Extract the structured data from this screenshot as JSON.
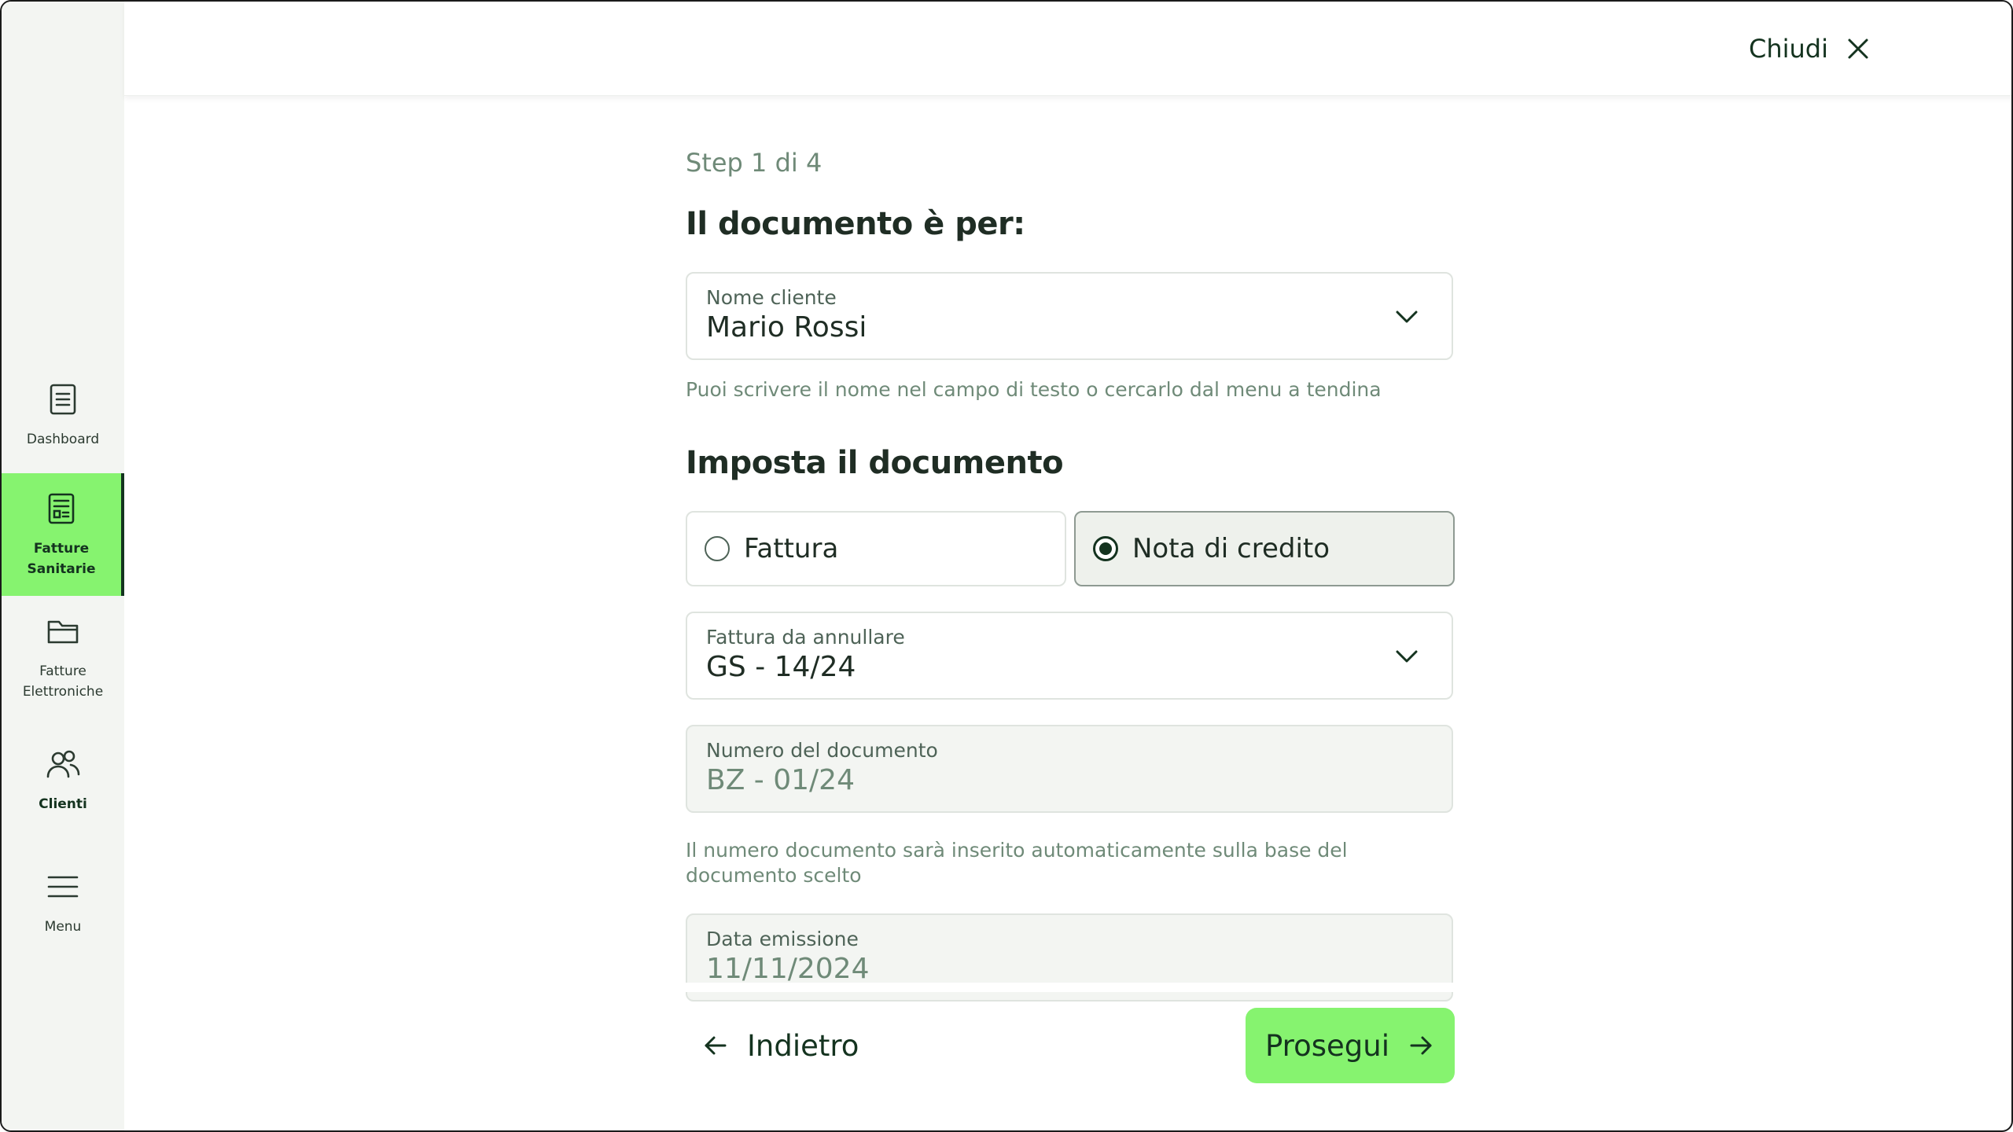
{
  "header": {
    "close_label": "Chiudi"
  },
  "sidebar": {
    "items": [
      {
        "label": "Dashboard",
        "icon": "document-list-icon"
      },
      {
        "label": "Fatture Sanitarie",
        "icon": "invoice-icon",
        "active": true
      },
      {
        "label": "Fatture Elettroniche",
        "icon": "folder-icon"
      },
      {
        "label": "Clienti",
        "icon": "users-icon"
      },
      {
        "label": "Menu",
        "icon": "hamburger-icon"
      }
    ]
  },
  "form": {
    "step": "Step 1 di 4",
    "title": "Il documento è per:",
    "client_field": {
      "label": "Nome cliente",
      "value": "Mario Rossi"
    },
    "client_help": "Puoi scrivere il nome nel campo di testo o cercarlo dal menu a tendina",
    "section_title": "Imposta il documento",
    "doc_type": {
      "options": [
        "Fattura",
        "Nota di credito"
      ],
      "selected": "Nota di credito"
    },
    "invoice_to_cancel": {
      "label": "Fattura da annullare",
      "value": "GS - 14/24"
    },
    "doc_number": {
      "label": "Numero del documento",
      "value": "BZ - 01/24"
    },
    "doc_number_help": "Il numero documento sarà inserito automaticamente sulla base del documento scelto",
    "issue_date": {
      "label": "Data emissione",
      "value": "11/11/2024"
    }
  },
  "footer": {
    "back_label": "Indietro",
    "next_label": "Prosegui"
  },
  "colors": {
    "accent": "#86f36f",
    "dark_green": "#14331f",
    "muted_text": "#6f8a78",
    "sidebar_bg": "#f3f5f2"
  }
}
